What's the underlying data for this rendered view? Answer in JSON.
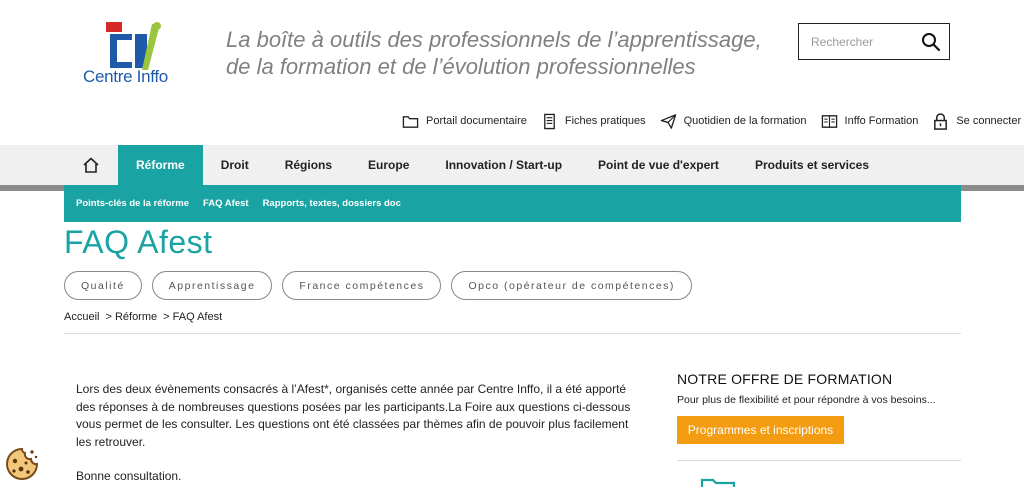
{
  "header": {
    "logo_text": "Centre Inffo",
    "tagline": "La boîte à outils des professionnels de l’apprentissage, de la formation et de l’évolution professionnelles",
    "search_placeholder": "Rechercher",
    "utility_links": [
      {
        "label": "Portail documentaire",
        "icon": "folder-icon"
      },
      {
        "label": "Fiches pratiques",
        "icon": "document-icon"
      },
      {
        "label": "Quotidien de la formation",
        "icon": "paper-plane-icon"
      },
      {
        "label": "Inffo Formation",
        "icon": "newspaper-icon"
      },
      {
        "label": "Se connecter",
        "icon": "lock-icon"
      }
    ]
  },
  "nav": {
    "items": [
      "Réforme",
      "Droit",
      "Régions",
      "Europe",
      "Innovation / Start-up",
      "Point de vue d'expert",
      "Produits et services"
    ],
    "active": "Réforme"
  },
  "subnav": {
    "items": [
      "Points-clés de la réforme",
      "FAQ Afest",
      "Rapports, textes, dossiers doc"
    ]
  },
  "page": {
    "title": "FAQ Afest",
    "tags": [
      "Qualité",
      "Apprentissage",
      "France compétences",
      "Opco (opérateur de compétences)"
    ],
    "breadcrumb": [
      "Accueil",
      "> Réforme",
      "> FAQ Afest"
    ],
    "intro": [
      "Lors des deux évènements consacrés à l’Afest*, organisés cette année par Centre Inffo, il a été apporté des réponses à de nombreuses questions posées par les participants.La Foire aux questions ci-dessous vous permet de les consulter. Les questions ont été classées par thèmes afin de pouvoir plus facilement les retrouver.",
      "Bonne consultation."
    ]
  },
  "sidebar": {
    "title": "NOTRE OFFRE DE FORMATION",
    "subtitle": "Pour plus de flexibilité et pour répondre à vos besoins...",
    "button_label": "Programmes et inscriptions"
  },
  "colors": {
    "teal": "#1aa3a3",
    "orange": "#f39c12",
    "logo_blue": "#1e5aa8",
    "logo_green": "#9bc53d",
    "logo_red": "#d62828"
  }
}
